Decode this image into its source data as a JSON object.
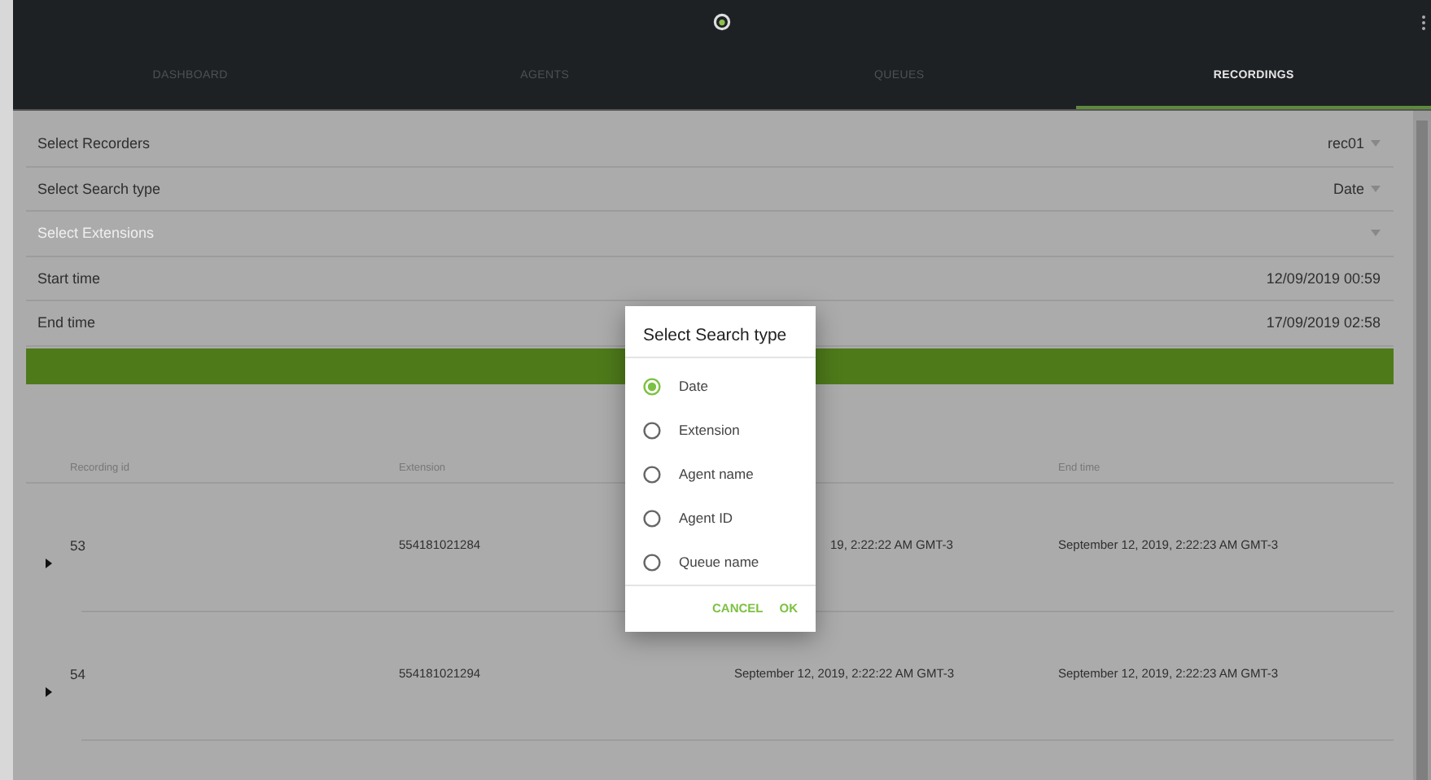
{
  "header": {
    "tabs": [
      {
        "label": "DASHBOARD",
        "selected": false
      },
      {
        "label": "AGENTS",
        "selected": false
      },
      {
        "label": "QUEUES",
        "selected": false
      },
      {
        "label": "RECORDINGS",
        "selected": true
      }
    ]
  },
  "form": {
    "fields": [
      {
        "label": "Select Recorders",
        "value": "rec01",
        "dropdown": true,
        "disabled": false
      },
      {
        "label": "Select Search type",
        "value": "Date",
        "dropdown": true,
        "disabled": false
      },
      {
        "label": "Select Extensions",
        "dropdown": true,
        "disabled": true
      },
      {
        "label": "Start time",
        "value": "12/09/2019 00:59",
        "dropdown": false,
        "disabled": false
      },
      {
        "label": "End time",
        "value": "17/09/2019 02:58",
        "dropdown": false,
        "disabled": false
      }
    ]
  },
  "table": {
    "header": {
      "recording_id": "Recording id",
      "extension": "Extension",
      "end_time": "End time"
    },
    "rows": [
      {
        "recording_id": "53",
        "extension": "554181021284",
        "start_time": "19, 2:22:22 AM GMT-3",
        "start_time_covered": true,
        "end_time": "September 12, 2019, 2:22:23 AM GMT-3"
      },
      {
        "recording_id": "54",
        "extension": "554181021294",
        "start_time": "September 12, 2019, 2:22:22 AM GMT-3",
        "start_time_covered": false,
        "end_time": "September 12, 2019, 2:22:23 AM GMT-3"
      }
    ]
  },
  "dialog": {
    "title": "Select Search type",
    "options": [
      {
        "label": "Date",
        "selected": true
      },
      {
        "label": "Extension",
        "selected": false
      },
      {
        "label": "Agent name",
        "selected": false
      },
      {
        "label": "Agent ID",
        "selected": false
      },
      {
        "label": "Queue name",
        "selected": false
      }
    ],
    "buttons": [
      "CANCEL",
      "OK"
    ]
  }
}
